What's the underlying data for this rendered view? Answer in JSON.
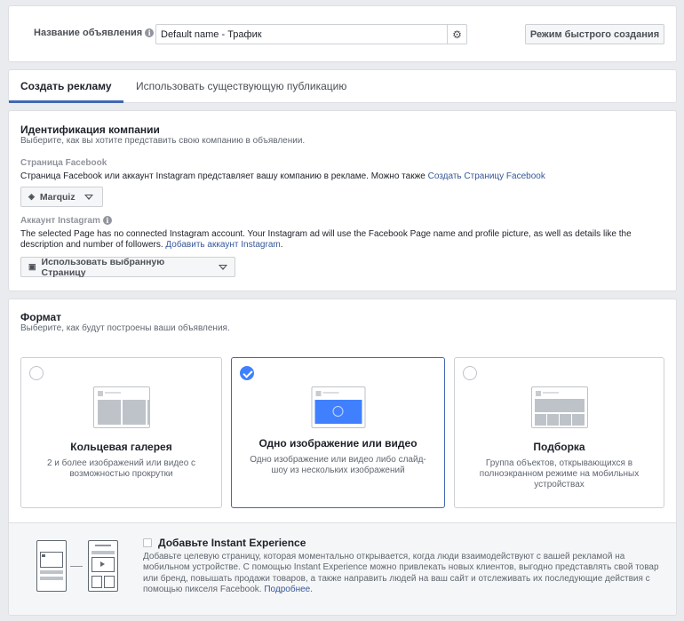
{
  "header": {
    "name_label": "Название объявления",
    "name_value": "Default name - Трафик",
    "quick_create_button": "Режим быстрого создания"
  },
  "tabs": [
    {
      "label": "Создать рекламу",
      "active": true
    },
    {
      "label": "Использовать существующую публикацию",
      "active": false
    }
  ],
  "identity": {
    "title": "Идентификация компании",
    "subtitle": "Выберите, как вы хотите представить свою компанию в объявлении.",
    "facebook_label": "Страница Facebook",
    "facebook_text": "Страница Facebook или аккаунт Instagram представляет вашу компанию в рекламе. Можно также",
    "facebook_link": "Создать Страницу Facebook",
    "page_dropdown": "Marquiz",
    "instagram_label": "Аккаунт Instagram",
    "instagram_text_line1": "The selected Page has no connected Instagram account. Your Instagram ad will use the Facebook Page name and profile picture, as well as details like the",
    "instagram_text_line2": "description and number of followers.",
    "instagram_link": "Добавить аккаунт Instagram",
    "instagram_dropdown": "Использовать выбранную Страницу"
  },
  "format": {
    "title": "Формат",
    "subtitle": "Выберите, как будут построены ваши объявления.",
    "options": [
      {
        "title": "Кольцевая галерея",
        "desc": "2 и более изображений или видео с возможностью прокрутки",
        "selected": false
      },
      {
        "title": "Одно изображение или видео",
        "desc": "Одно изображение или видео либо слайд-шоу из нескольких изображений",
        "selected": true
      },
      {
        "title": "Подборка",
        "desc": "Группа объектов, открывающихся в полноэкранном режиме на мобильных устройствах",
        "selected": false
      }
    ],
    "instant_experience": {
      "title": "Добавьте Instant Experience",
      "desc": "Добавьте целевую страницу, которая моментально открывается, когда люди взаимодействуют с вашей рекламой на мобильном устройстве. С помощью Instant Experience можно привлекать новых клиентов, выгодно представлять свой товар или бренд, повышать продажи товаров, а также направить людей на ваш сайт и отслеживать их последующие действия с помощью пикселя Facebook.",
      "link": "Подробнее."
    }
  },
  "colors": {
    "accent": "#4267b2",
    "check": "#4080ff",
    "link": "#365899",
    "background": "#e9ebee"
  }
}
